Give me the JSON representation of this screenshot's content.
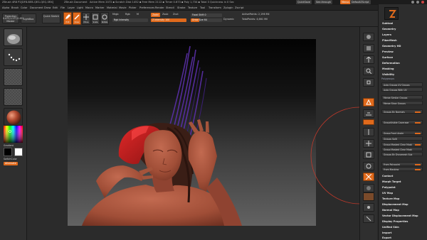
{
  "titlebar": {
    "app": "ZBrush 4R8 P2[DF8-BEB-QEG-QEQ-SRX]",
    "doc": "ZBrush Document",
    "stats": "Active Mem 2072 ▪ Scratch Disk 1452 ▪ Free Mem 2112 ▪ Timer 0.673 ▪ Poly 1,734 ▪ Total 3 Quickness in 0 Sec",
    "quicksave": "QuickSave",
    "seethrough": "See-through",
    "menus": "Menus",
    "script": "DefaultZScript"
  },
  "menubar": {
    "items": [
      "Alpha",
      "Brush",
      "Color",
      "Document",
      "Draw",
      "Edit",
      "File",
      "Layer",
      "Light",
      "Macro",
      "Marker",
      "Material",
      "Movie",
      "Picker",
      "Preferences",
      "Render",
      "Stencil",
      "Stroke",
      "Texture",
      "Tool",
      "Transform",
      "Zplugin",
      "Zscript"
    ]
  },
  "toolbar": {
    "projection_master": "Projection Master",
    "lightbox": "LightBox",
    "quick_sketch": "Quick Sketch",
    "edit": "Edit",
    "draw": "Draw",
    "move": "Move",
    "scale": "Scale",
    "rotate": "Rotate",
    "mrgb": "Mrgb",
    "rgb": "Rgb",
    "m": "M",
    "zadd": "Zadd",
    "zsub": "Zsub",
    "zcut": "Zcut",
    "rgb_intensity": "Rgb Intensity",
    "z_intensity": "Z Intensity 100",
    "focal_shift": "Focal Shift 0",
    "draw_size": "Draw Size 64",
    "dynamic": "Dynamic",
    "active_points": "ActivePoints: 2,196 Mil",
    "total_points": "TotalPoints: 4,661 Mil"
  },
  "left": {
    "coord": "0.471,1.177,0.451",
    "gradient": "Gradient",
    "switch_color": "SwitchColor",
    "alternate": "Alternate"
  },
  "rightpanel": {
    "items": [
      "Subtool",
      "Geometry",
      "Layers",
      "FiberMesh",
      "Geometry HD",
      "Preview",
      "Surface",
      "Deformation",
      "Masking",
      "Visibility",
      "Polygroups"
    ],
    "polygroups_head": "Polygroups",
    "polygroup_buttons": [
      "Auto Groups   UV Groups",
      "Auto Groups With UV",
      "Merge Similar Groups",
      "Merge Stray Groups",
      "Groups By Normals",
      "GroupVisible  Coverage",
      "Group Front  Angle",
      "Groups Split",
      "Group Masked  Clear Mask",
      "Group Masked Clear Mask",
      "Groups By Dynamesh Sub",
      "From Polypaint",
      "From Masking"
    ],
    "lower_items": [
      "Contact",
      "Morph Target",
      "Polypaint",
      "UV Map",
      "Texture Map",
      "Displacement Map",
      "Normal Map",
      "Vector Displacement Map",
      "Display Properties",
      "Unified Skin",
      "Import",
      "Export"
    ]
  },
  "colors": {
    "accent": "#e06a1c",
    "panel": "#2d2d2d",
    "skin": "#a4543b",
    "hair_red": "#c21f1f",
    "hair_purple": "#5b2fa8"
  }
}
